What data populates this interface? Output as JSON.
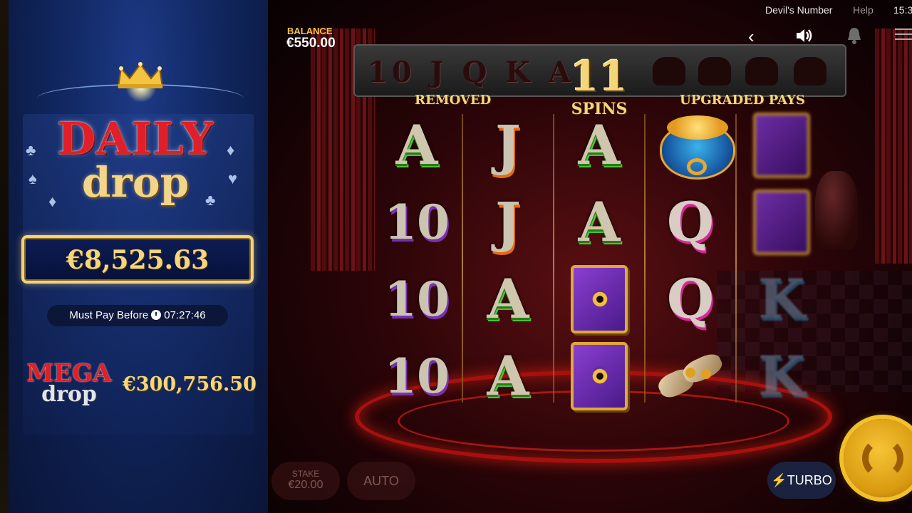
{
  "topbar": {
    "game_title": "Devil's Number",
    "help_label": "Help",
    "time": "15:3"
  },
  "balance": {
    "label": "BALANCE",
    "value": "€550.00"
  },
  "daily_drop": {
    "title": "DAILY",
    "subtitle": "drop",
    "amount": "€8,525.63",
    "must_pay_label": "Must Pay Before",
    "must_pay_time": "07:27:46"
  },
  "mega_drop": {
    "title": "MEGA",
    "subtitle": "drop",
    "amount": "€300,756.50"
  },
  "banner": {
    "removed_cards": "10 J Q K A",
    "removed_label": "REMOVED",
    "spins_count": "11",
    "spins_label": "SPINS",
    "upgraded_label": "UPGRADED PAYS"
  },
  "reels": [
    [
      "A",
      "10",
      "10",
      "10"
    ],
    [
      "J",
      "J",
      "A",
      "A"
    ],
    [
      "A",
      "A",
      "book",
      "book"
    ],
    [
      "cauldron",
      "Q",
      "Q",
      "scrolls"
    ],
    [
      "book-blur",
      "book-blur",
      "K",
      "K"
    ]
  ],
  "controls": {
    "stake_label": "STAKE",
    "stake_value": "€20.00",
    "auto_label": "AUTO",
    "turbo_label": "TURBO"
  },
  "icons": {
    "back": "chevron-left-icon",
    "sound": "speaker-icon",
    "notifications": "bell-icon",
    "menu": "hamburger-icon",
    "spin": "spin-arrows-icon",
    "turbo": "lightning-icon",
    "clock": "clock-icon"
  },
  "colors": {
    "accent_gold": "#f4d57a",
    "jackpot_red": "#e21e28",
    "panel_blue": "#122a66"
  }
}
